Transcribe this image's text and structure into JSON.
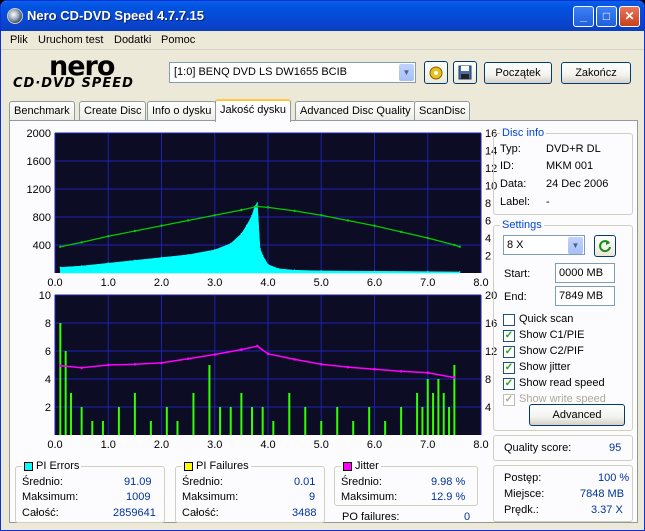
{
  "window": {
    "title": "Nero CD-DVD Speed 4.7.7.15"
  },
  "menu": [
    "Plik",
    "Uruchom test",
    "Dodatki",
    "Pomoc"
  ],
  "logo": {
    "top": "nero",
    "bottom": "CD·DVD SPEED"
  },
  "toolbar": {
    "drive": "[1:0]  BENQ DVD LS DW1655 BCIB",
    "start_label": "Początek",
    "exit_label": "Zakończ"
  },
  "tabs": [
    "Benchmark",
    "Create Disc",
    "Info o dysku",
    "Jakość dysku",
    "Advanced Disc Quality",
    "ScanDisc"
  ],
  "active_tab": 3,
  "disc_info": {
    "title": "Disc info",
    "rows": [
      {
        "label": "Typ:",
        "value": "DVD+R DL"
      },
      {
        "label": "ID:",
        "value": "MKM 001"
      },
      {
        "label": "Data:",
        "value": "24 Dec 2006"
      },
      {
        "label": "Label:",
        "value": "-"
      }
    ]
  },
  "settings": {
    "title": "Settings",
    "speed": "8 X",
    "start_label": "Start:",
    "start": "0000 MB",
    "end_label": "End:",
    "end": "7849 MB",
    "checks": [
      {
        "label": "Quick scan",
        "checked": false,
        "disabled": false
      },
      {
        "label": "Show C1/PIE",
        "checked": true,
        "disabled": false
      },
      {
        "label": "Show C2/PIF",
        "checked": true,
        "disabled": false
      },
      {
        "label": "Show jitter",
        "checked": true,
        "disabled": false
      },
      {
        "label": "Show read speed",
        "checked": true,
        "disabled": false
      },
      {
        "label": "Show write speed",
        "checked": true,
        "disabled": true
      }
    ],
    "advanced_label": "Advanced"
  },
  "quality": {
    "label": "Quality score:",
    "value": "95"
  },
  "progress": {
    "rows": [
      {
        "label": "Postęp:",
        "value": "100 %"
      },
      {
        "label": "Miejsce:",
        "value": "7848 MB"
      },
      {
        "label": "Prędk.:",
        "value": "3.37 X"
      }
    ]
  },
  "pi_errors": {
    "title": "PI Errors",
    "color": "#00ffff",
    "rows": [
      {
        "label": "Średnio:",
        "value": "91.09"
      },
      {
        "label": "Maksimum:",
        "value": "1009"
      },
      {
        "label": "Całość:",
        "value": "2859641"
      }
    ]
  },
  "pi_failures": {
    "title": "PI Failures",
    "color": "#ffff00",
    "rows": [
      {
        "label": "Średnio:",
        "value": "0.01"
      },
      {
        "label": "Maksimum:",
        "value": "9"
      },
      {
        "label": "Całość:",
        "value": "3488"
      }
    ]
  },
  "jitter": {
    "title": "Jitter",
    "color": "#ff00ff",
    "rows": [
      {
        "label": "Średnio:",
        "value": "9.98 %"
      },
      {
        "label": "Maksimum:",
        "value": "12.9 %"
      }
    ],
    "po_label": "PO failures:",
    "po_value": "0"
  },
  "chart_data": [
    {
      "type": "area",
      "xlim": [
        0,
        8
      ],
      "ylim": [
        0,
        2000
      ],
      "y2lim": [
        0,
        16
      ],
      "x_ticks": [
        "0.0",
        "1.0",
        "2.0",
        "3.0",
        "4.0",
        "5.0",
        "6.0",
        "7.0",
        "8.0"
      ],
      "y_ticks": [
        "2000",
        "1600",
        "1200",
        "800",
        "400"
      ],
      "y2_ticks": [
        "16",
        "14",
        "12",
        "10",
        "8",
        "6",
        "4",
        "2"
      ],
      "series": [
        {
          "color": "#00ffff",
          "x": [
            0.1,
            0.5,
            1.0,
            1.5,
            2.0,
            2.5,
            3.0,
            3.3,
            3.5,
            3.6,
            3.7,
            3.75,
            3.8,
            3.85,
            3.9,
            4.0,
            4.2,
            4.5,
            5.0,
            6.0,
            7.0,
            7.6
          ],
          "y": [
            80,
            100,
            140,
            180,
            220,
            260,
            330,
            420,
            560,
            680,
            820,
            950,
            1000,
            350,
            250,
            120,
            60,
            40,
            30,
            25,
            20,
            15
          ]
        },
        {
          "color": "#00cc00",
          "x": [
            0.1,
            0.5,
            1.0,
            1.5,
            2.0,
            2.5,
            3.0,
            3.5,
            3.8,
            4.0,
            4.5,
            5.0,
            5.5,
            6.0,
            6.5,
            7.0,
            7.5,
            7.6
          ],
          "y": [
            3.0,
            3.5,
            4.2,
            4.8,
            5.4,
            6.0,
            6.6,
            7.2,
            7.6,
            7.5,
            7.1,
            6.6,
            6.0,
            5.4,
            4.7,
            4.0,
            3.2,
            3.0
          ]
        }
      ]
    },
    {
      "type": "bar",
      "xlim": [
        0,
        8
      ],
      "ylim": [
        0,
        10
      ],
      "y2lim": [
        0,
        20
      ],
      "x_ticks": [
        "0.0",
        "1.0",
        "2.0",
        "3.0",
        "4.0",
        "5.0",
        "6.0",
        "7.0",
        "8.0"
      ],
      "y_ticks": [
        "10",
        "8",
        "6",
        "4",
        "2"
      ],
      "y2_ticks": [
        "20",
        "16",
        "12",
        "8",
        "4"
      ],
      "series": [
        {
          "color": "#33ff00",
          "x": [
            0.1,
            0.2,
            0.3,
            0.5,
            0.7,
            0.9,
            1.2,
            1.5,
            1.8,
            2.1,
            2.3,
            2.6,
            2.9,
            3.1,
            3.3,
            3.5,
            3.7,
            3.9,
            4.1,
            4.4,
            4.7,
            5.0,
            5.3,
            5.6,
            5.9,
            6.2,
            6.5,
            6.8,
            6.9,
            7.0,
            7.1,
            7.2,
            7.3,
            7.4,
            7.5
          ],
          "y": [
            8,
            6,
            3,
            2,
            1,
            1,
            2,
            3,
            1,
            2,
            1,
            3,
            5,
            2,
            2,
            3,
            2,
            2,
            1,
            3,
            2,
            1,
            2,
            1,
            2,
            1,
            2,
            3,
            2,
            4,
            3,
            4,
            3,
            2,
            5
          ]
        },
        {
          "color": "#ff00ff",
          "x": [
            0.1,
            0.5,
            1.0,
            1.5,
            2.0,
            2.5,
            3.0,
            3.5,
            3.8,
            4.0,
            4.5,
            5.0,
            5.5,
            6.0,
            6.5,
            7.0,
            7.5
          ],
          "y": [
            9.9,
            9.6,
            10.0,
            10.1,
            10.3,
            10.9,
            11.5,
            12.2,
            12.7,
            11.6,
            10.8,
            10.1,
            9.7,
            9.4,
            9.1,
            8.9,
            8.2
          ]
        }
      ]
    }
  ]
}
